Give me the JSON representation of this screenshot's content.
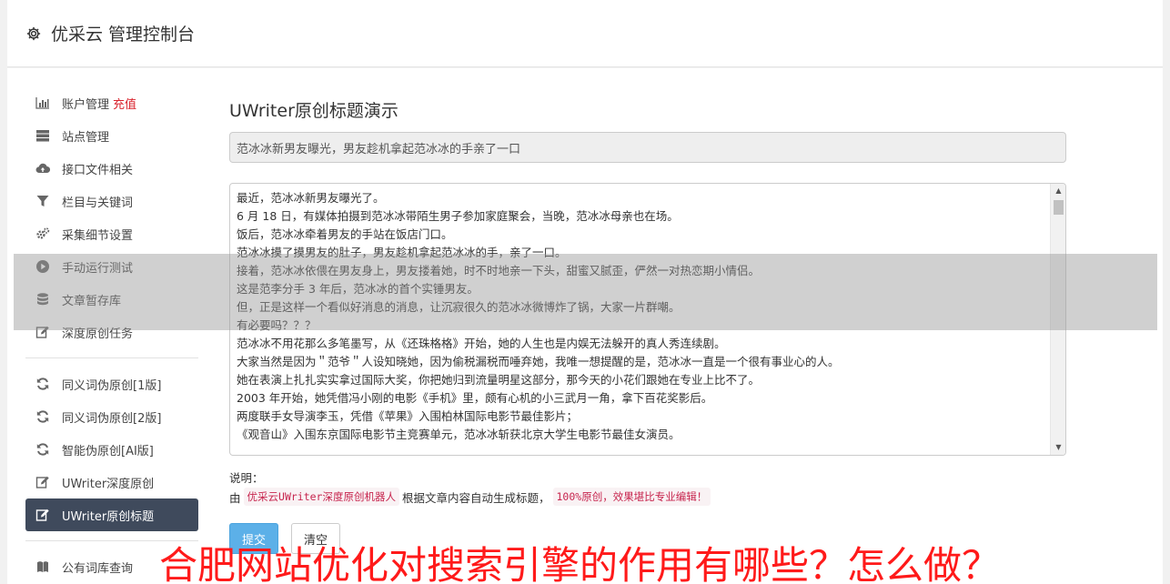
{
  "header": {
    "title": "优采云 管理控制台",
    "icon": "gear-icon"
  },
  "sidebar": {
    "group1": [
      {
        "label": "账户管理",
        "badge": "充值",
        "icon": "bar-chart-icon"
      },
      {
        "label": "站点管理",
        "icon": "server-icon"
      },
      {
        "label": "接口文件相关",
        "icon": "cloud-upload-icon"
      },
      {
        "label": "栏目与关键词",
        "icon": "filter-icon"
      },
      {
        "label": "采集细节设置",
        "icon": "gears-icon"
      },
      {
        "label": "手动运行测试",
        "icon": "play-circle-icon"
      },
      {
        "label": "文章暂存库",
        "icon": "database-icon"
      },
      {
        "label": "深度原创任务",
        "icon": "edit-icon"
      }
    ],
    "group2": [
      {
        "label": "同义词伪原创[1版]",
        "icon": "refresh-icon"
      },
      {
        "label": "同义词伪原创[2版]",
        "icon": "refresh-icon"
      },
      {
        "label": "智能伪原创[AI版]",
        "icon": "refresh-icon"
      },
      {
        "label": "UWriter深度原创",
        "icon": "edit-icon"
      },
      {
        "label": "UWriter原创标题",
        "icon": "edit-icon",
        "active": true
      }
    ],
    "group3": [
      {
        "label": "公有词库查询",
        "icon": "book-icon"
      }
    ]
  },
  "main": {
    "page_title": "UWriter原创标题演示",
    "title_value": "范冰冰新男友曝光，男友趁机拿起范冰冰的手亲了一口",
    "article_lines": [
      "最近，范冰冰新男友曝光了。",
      "6 月 18 日，有媒体拍摄到范冰冰带陌生男子参加家庭聚会，当晚，范冰冰母亲也在场。",
      "饭后，范冰冰牵着男友的手站在饭店门口。",
      "范冰冰摸了摸男友的肚子，男友趁机拿起范冰冰的手，亲了一口。",
      "接着，范冰冰依偎在男友身上，男友搂着她，时不时地亲一下头，甜蜜又腻歪，俨然一对热恋期小情侣。",
      "这是范李分手 3 年后，范冰冰的首个实锤男友。",
      "但，正是这样一个看似好消息的消息，让沉寂很久的范冰冰微博炸了锅，大家一片群嘲。",
      "有必要吗？？？",
      "范冰冰不用花那么多笔墨写，从《还珠格格》开始，她的人生也是内娱无法躲开的真人秀连续剧。",
      "大家当然是因为＂范爷＂人设知晓她，因为偷税漏税而唾弃她，我唯一想提醒的是，范冰冰一直是一个很有事业心的人。",
      "她在表演上扎扎实实拿过国际大奖，你把她归到流量明星这部分，那今天的小花们跟她在专业上比不了。",
      "2003 年开始，她凭借冯小刚的电影《手机》里，颇有心机的小三武月一角，拿下百花奖影后。",
      "两度联手女导演李玉，凭借《苹果》入围柏林国际电影节最佳影片；",
      "《观音山》入围东京国际电影节主竞赛单元，范冰冰斩获北京大学生电影节最佳女演员。"
    ],
    "desc_label": "说明：",
    "desc_prefix": "由",
    "desc_code1": "优采云UWriter深度原创机器人",
    "desc_middle": "根据文章内容自动生成标题，",
    "desc_code2": "100%原创，效果堪比专业编辑！",
    "submit_label": "提交",
    "clear_label": "清空"
  },
  "overlay": {
    "banner_text": "合肥网站优化对搜索引擎的作用有哪些？怎么做？"
  }
}
